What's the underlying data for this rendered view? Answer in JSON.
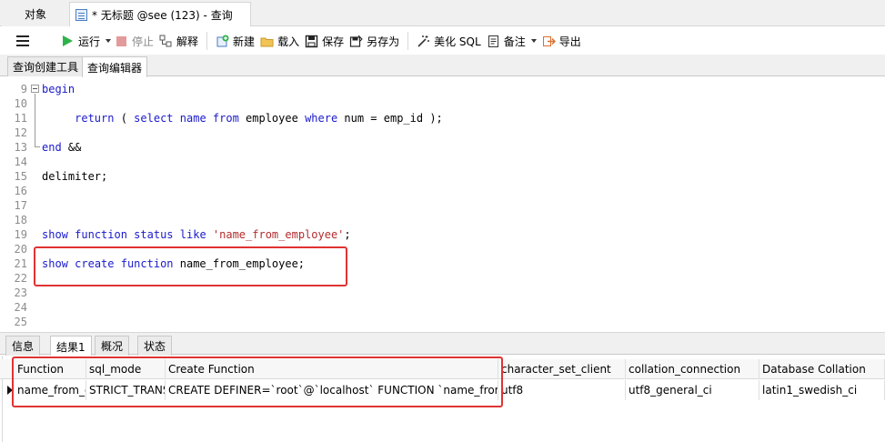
{
  "tabs": {
    "objects": "对象",
    "query": "* 无标题 @see (123) - 查询"
  },
  "toolbar": {
    "run": "运行",
    "stop": "停止",
    "explain": "解释",
    "new": "新建",
    "load": "载入",
    "save": "保存",
    "save_as": "另存为",
    "beautify": "美化 SQL",
    "note": "备注",
    "export": "导出"
  },
  "subtabs": {
    "builder": "查询创建工具",
    "editor": "查询编辑器"
  },
  "editor": {
    "lines": [
      {
        "num": "9",
        "segments": [
          {
            "t": "begin",
            "c": "kw"
          }
        ]
      },
      {
        "num": "10",
        "segments": []
      },
      {
        "num": "11",
        "segments": [
          {
            "t": "     ",
            "c": ""
          },
          {
            "t": "return",
            "c": "kw"
          },
          {
            "t": " ( ",
            "c": ""
          },
          {
            "t": "select",
            "c": "kw"
          },
          {
            "t": " ",
            "c": ""
          },
          {
            "t": "name",
            "c": "kw"
          },
          {
            "t": " ",
            "c": ""
          },
          {
            "t": "from",
            "c": "kw"
          },
          {
            "t": " employee ",
            "c": ""
          },
          {
            "t": "where",
            "c": "kw"
          },
          {
            "t": " num = emp_id );",
            "c": ""
          }
        ]
      },
      {
        "num": "12",
        "segments": []
      },
      {
        "num": "13",
        "segments": [
          {
            "t": "end",
            "c": "kw"
          },
          {
            "t": " &&",
            "c": ""
          }
        ]
      },
      {
        "num": "14",
        "segments": []
      },
      {
        "num": "15",
        "segments": [
          {
            "t": "delimiter;",
            "c": ""
          }
        ]
      },
      {
        "num": "16",
        "segments": []
      },
      {
        "num": "17",
        "segments": []
      },
      {
        "num": "18",
        "segments": []
      },
      {
        "num": "19",
        "segments": [
          {
            "t": "show",
            "c": "kw"
          },
          {
            "t": " ",
            "c": ""
          },
          {
            "t": "function",
            "c": "kw"
          },
          {
            "t": " ",
            "c": ""
          },
          {
            "t": "status",
            "c": "kw"
          },
          {
            "t": " ",
            "c": ""
          },
          {
            "t": "like",
            "c": "kw"
          },
          {
            "t": " ",
            "c": ""
          },
          {
            "t": "'name_from_employee'",
            "c": "str"
          },
          {
            "t": ";",
            "c": ""
          }
        ]
      },
      {
        "num": "20",
        "segments": []
      },
      {
        "num": "21",
        "segments": [
          {
            "t": "show",
            "c": "kw"
          },
          {
            "t": " ",
            "c": ""
          },
          {
            "t": "create",
            "c": "kw"
          },
          {
            "t": " ",
            "c": ""
          },
          {
            "t": "function",
            "c": "kw"
          },
          {
            "t": " name_from_employee;",
            "c": ""
          }
        ]
      },
      {
        "num": "22",
        "segments": []
      },
      {
        "num": "23",
        "segments": []
      },
      {
        "num": "24",
        "segments": []
      },
      {
        "num": "25",
        "segments": []
      }
    ]
  },
  "result_tabs": [
    "信息",
    "结果1",
    "概况",
    "状态"
  ],
  "grid": {
    "columns": [
      "Function",
      "sql_mode",
      "Create Function",
      "character_set_client",
      "collation_connection",
      "Database Collation"
    ],
    "rows": [
      [
        "name_from_employee",
        "STRICT_TRANS_TABLES",
        "CREATE DEFINER=`root`@`localhost` FUNCTION `name_from_employee`",
        "utf8",
        "utf8_general_ci",
        "latin1_swedish_ci"
      ]
    ]
  },
  "colors": {
    "keyword": "#1a1acc",
    "string": "#b52c2c",
    "highlight": "#e03333",
    "run_icon": "#2db34a"
  }
}
